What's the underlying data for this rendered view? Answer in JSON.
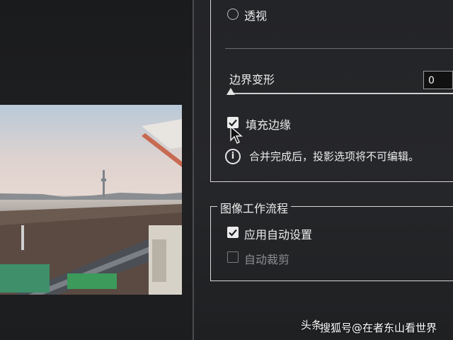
{
  "options": {
    "perspective_label": "透视",
    "boundary_warp_label": "边界变形",
    "boundary_warp_value": "0",
    "boundary_warp_level": 0,
    "fill_edges_label": "填充边缘",
    "fill_edges_checked": true,
    "info_text": "合并完成后，投影选项将不可编辑。"
  },
  "workflow": {
    "title": "图像工作流程",
    "auto_settings_label": "应用自动设置",
    "auto_settings_checked": true,
    "auto_crop_label": "自动裁剪",
    "auto_crop_checked": false
  },
  "watermark": {
    "line1": "头条",
    "line2": "搜狐号@在者东山看世界"
  },
  "icons": {
    "info": "info-icon",
    "cursor": "mouse-cursor-icon",
    "check": "check-icon"
  },
  "colors": {
    "panel_bg": "#26272a",
    "border": "#d8d8d8",
    "text": "#ececec",
    "disabled_text": "#8d8e91"
  }
}
